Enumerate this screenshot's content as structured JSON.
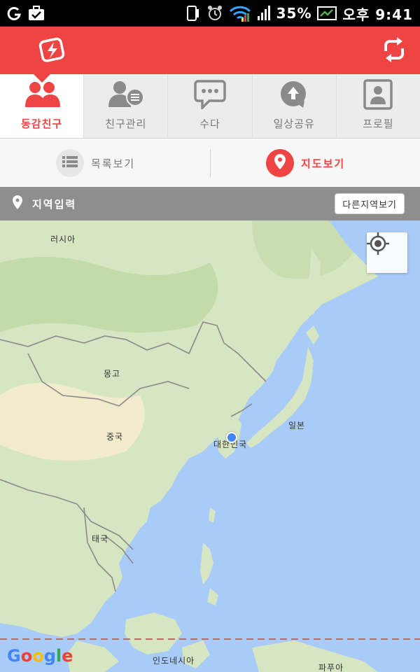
{
  "status_bar": {
    "battery": "35%",
    "time": "오후 9:41"
  },
  "header": {
    "accent_color": "#ef4444",
    "left_icon": "battery-bolt-icon",
    "right_icon": "refresh-icon"
  },
  "tabs": [
    {
      "label": "동감친구",
      "icon": "friends-icon",
      "active": true
    },
    {
      "label": "친구관리",
      "icon": "friend-list-icon",
      "active": false
    },
    {
      "label": "수다",
      "icon": "chat-bubble-icon",
      "active": false
    },
    {
      "label": "일상공유",
      "icon": "cloud-upload-icon",
      "active": false
    },
    {
      "label": "프로필",
      "icon": "profile-icon",
      "active": false
    }
  ],
  "view_toggle": {
    "list_label": "목록보기",
    "map_label": "지도보기",
    "selected": "map"
  },
  "region_bar": {
    "placeholder": "지역입력",
    "button_label": "다른지역보기"
  },
  "map": {
    "labels": [
      "러시아",
      "몽고",
      "중국",
      "대한민국",
      "일본",
      "태국",
      "인도네시아",
      "파푸아"
    ],
    "google_logo": [
      "G",
      "o",
      "o",
      "g",
      "l",
      "e"
    ],
    "land_color": "#d7e6c2",
    "water_color": "#a9cbf7",
    "location_dot_color": "#4285f4"
  }
}
